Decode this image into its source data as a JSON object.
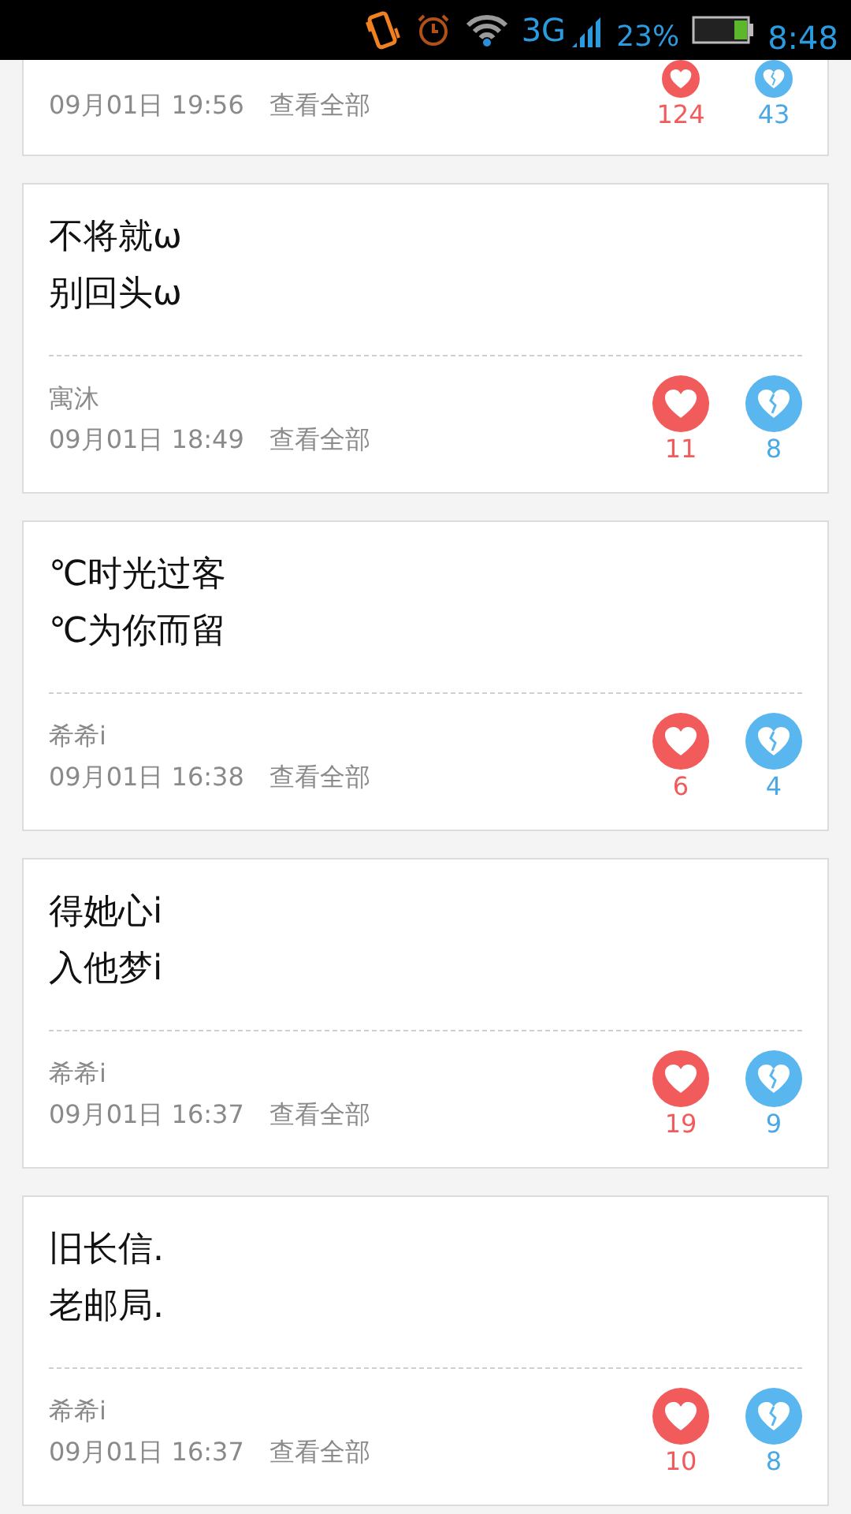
{
  "status_bar": {
    "network": "3G",
    "battery": "23%",
    "time": "8:48"
  },
  "posts": [
    {
      "date": "09月01日 19:56",
      "view_all": "查看全部",
      "likes": "124",
      "dislikes": "43"
    },
    {
      "lines": [
        "不将就ω",
        "别回头ω"
      ],
      "author": "寓沐",
      "date": "09月01日 18:49",
      "view_all": "查看全部",
      "likes": "11",
      "dislikes": "8"
    },
    {
      "lines": [
        "℃时光过客",
        "℃为你而留"
      ],
      "author": "希希i",
      "date": "09月01日 16:38",
      "view_all": "查看全部",
      "likes": "6",
      "dislikes": "4"
    },
    {
      "lines": [
        "得她心i",
        "入他梦i"
      ],
      "author": "希希i",
      "date": "09月01日 16:37",
      "view_all": "查看全部",
      "likes": "19",
      "dislikes": "9"
    },
    {
      "lines": [
        "旧长信.",
        "老邮局."
      ],
      "author": "希希i",
      "date": "09月01日 16:37",
      "view_all": "查看全部",
      "likes": "10",
      "dislikes": "8"
    }
  ]
}
